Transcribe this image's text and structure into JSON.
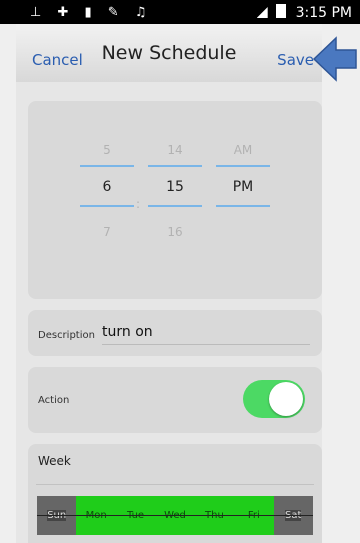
{
  "status_bar": {
    "icons_left": "⊥ ✚ ▮ ✎ ♫",
    "time": "3:15 PM"
  },
  "header": {
    "cancel_label": "Cancel",
    "title": "New Schedule",
    "save_label": "Save"
  },
  "picker": {
    "hours": [
      "5",
      "6",
      "7"
    ],
    "separator": ":",
    "minutes": [
      "14",
      "15",
      "16"
    ],
    "ampm": [
      "AM",
      "PM",
      ""
    ]
  },
  "description": {
    "label": "Description",
    "value": "turn on"
  },
  "action": {
    "label": "Action",
    "enabled": true
  },
  "week": {
    "label": "Week",
    "days": [
      {
        "label": "Sun",
        "selected": false
      },
      {
        "label": "Mon",
        "selected": true
      },
      {
        "label": "Tue",
        "selected": true
      },
      {
        "label": "Wed",
        "selected": true
      },
      {
        "label": "Thu",
        "selected": true
      },
      {
        "label": "Fri",
        "selected": true
      },
      {
        "label": "Sat",
        "selected": false
      }
    ]
  },
  "colors": {
    "accent": "#2a5db0",
    "toggle_on": "#4cd964",
    "day_selected": "#1fcd1a",
    "day_unselected": "#666666",
    "callout_arrow": "#4a78c0"
  }
}
